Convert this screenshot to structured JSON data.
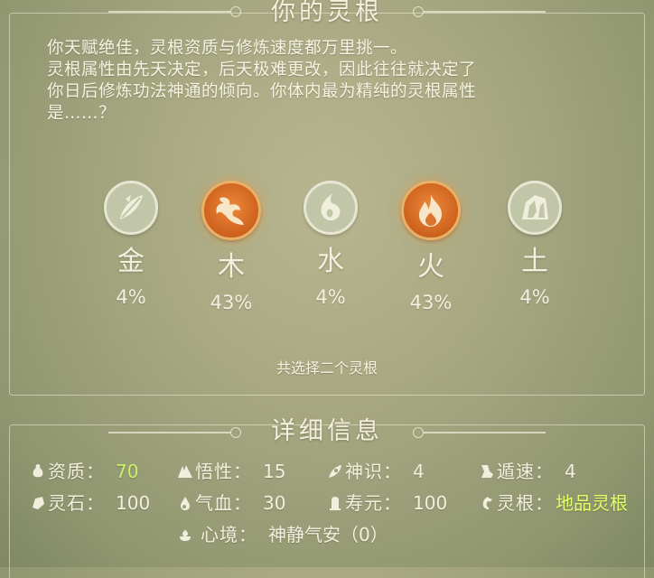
{
  "title": "你的灵根",
  "description": [
    "你天赋绝佳，灵根资质与修炼速度都万里挑一。",
    "灵根属性由先天决定，后天极难更改，因此往往就决定了",
    "你日后修炼功法神通的倾向。你体内最为精纯的灵根属性",
    "是……？"
  ],
  "elements": [
    {
      "name": "金",
      "percent": "4%",
      "icon": "metal-leaf-icon",
      "highlighted": false
    },
    {
      "name": "木",
      "percent": "43%",
      "icon": "wood-sprout-icon",
      "highlighted": true
    },
    {
      "name": "水",
      "percent": "4%",
      "icon": "water-drop-icon",
      "highlighted": false
    },
    {
      "name": "火",
      "percent": "43%",
      "icon": "fire-flame-icon",
      "highlighted": true
    },
    {
      "name": "土",
      "percent": "4%",
      "icon": "earth-rock-icon",
      "highlighted": false
    }
  ],
  "select_hint": "共选择二个灵根",
  "detail_title": "详细信息",
  "stats": {
    "aptitude": {
      "label": "资质：",
      "value": "70"
    },
    "comprehension": {
      "label": "悟性：",
      "value": "15"
    },
    "spirit_sense": {
      "label": "神识：",
      "value": "4"
    },
    "escape_speed": {
      "label": "遁速：",
      "value": "4"
    },
    "spirit_stone": {
      "label": "灵石：",
      "value": "100"
    },
    "qi_blood": {
      "label": "气血：",
      "value": "30"
    },
    "lifespan": {
      "label": "寿元：",
      "value": "100"
    },
    "spirit_root": {
      "label": "灵根：",
      "value": "地品灵根"
    },
    "mind_state": {
      "label": "心境：",
      "value": "神静气安（0）"
    }
  },
  "colors": {
    "highlight_orange": "#d0641f",
    "aptitude_green": "#c9f06a",
    "root_green": "#e2ff6a",
    "panel_text": "#f3f0e0"
  }
}
